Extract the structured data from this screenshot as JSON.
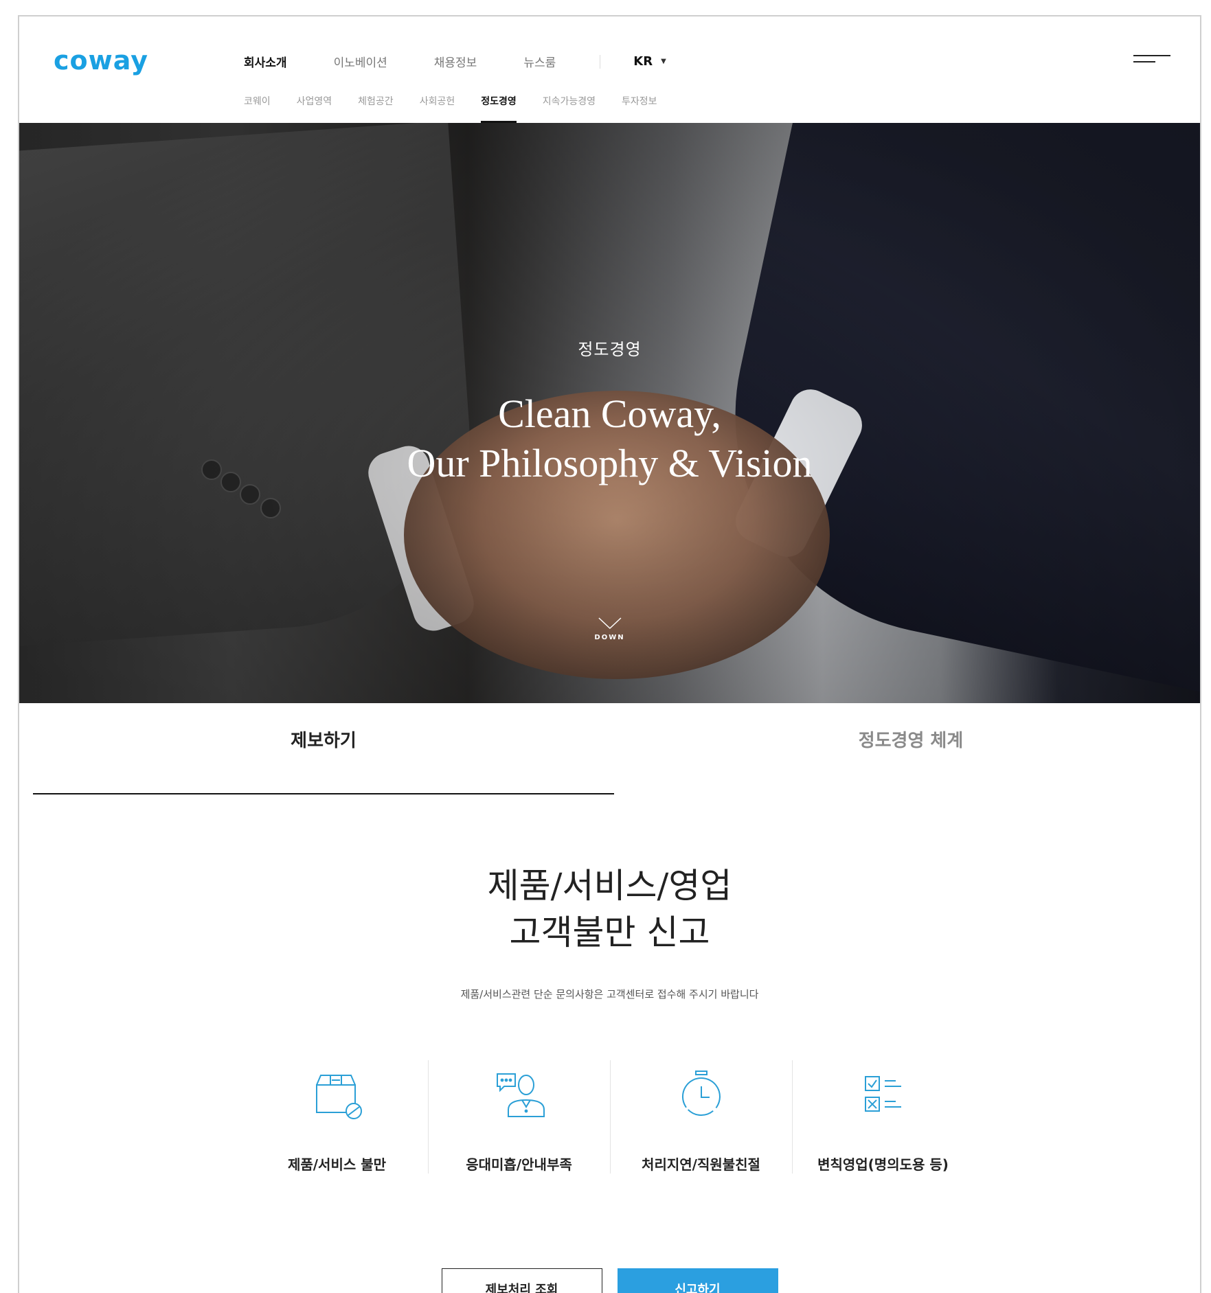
{
  "header": {
    "logo": "coway",
    "gnb": [
      "회사소개",
      "이노베이션",
      "채용정보",
      "뉴스룸"
    ],
    "gnb_active": 0,
    "lang": "KR",
    "snb": [
      "코웨이",
      "사업영역",
      "체험공간",
      "사회공헌",
      "정도경영",
      "지속가능경영",
      "투자정보"
    ],
    "snb_active": 4
  },
  "hero": {
    "eyebrow": "정도경영",
    "title_line1": "Clean Coway,",
    "title_line2": "Our Philosophy & Vision",
    "down_label": "DOWN"
  },
  "tabs": {
    "report": "제보하기",
    "system": "정도경영 체계"
  },
  "content": {
    "title_line1": "제품/서비스/영업",
    "title_line2": "고객불만 신고",
    "subtitle": "제품/서비스관련 단순 문의사항은 고객센터로 접수해 주시기 바랍니다",
    "categories": [
      {
        "label": "제품/서비스 불만",
        "icon": "product-box-icon"
      },
      {
        "label": "응대미흡/안내부족",
        "icon": "consultant-chat-icon"
      },
      {
        "label": "처리지연/직원불친절",
        "icon": "stopwatch-icon"
      },
      {
        "label": "변칙영업(명의도용 등)",
        "icon": "checklist-icon"
      }
    ],
    "btn_lookup": "제보처리 조회",
    "btn_report": "신고하기"
  },
  "colors": {
    "brand": "#1aa0e2",
    "primary_button": "#2b9fe0",
    "icon_stroke": "#2a9fd6"
  }
}
